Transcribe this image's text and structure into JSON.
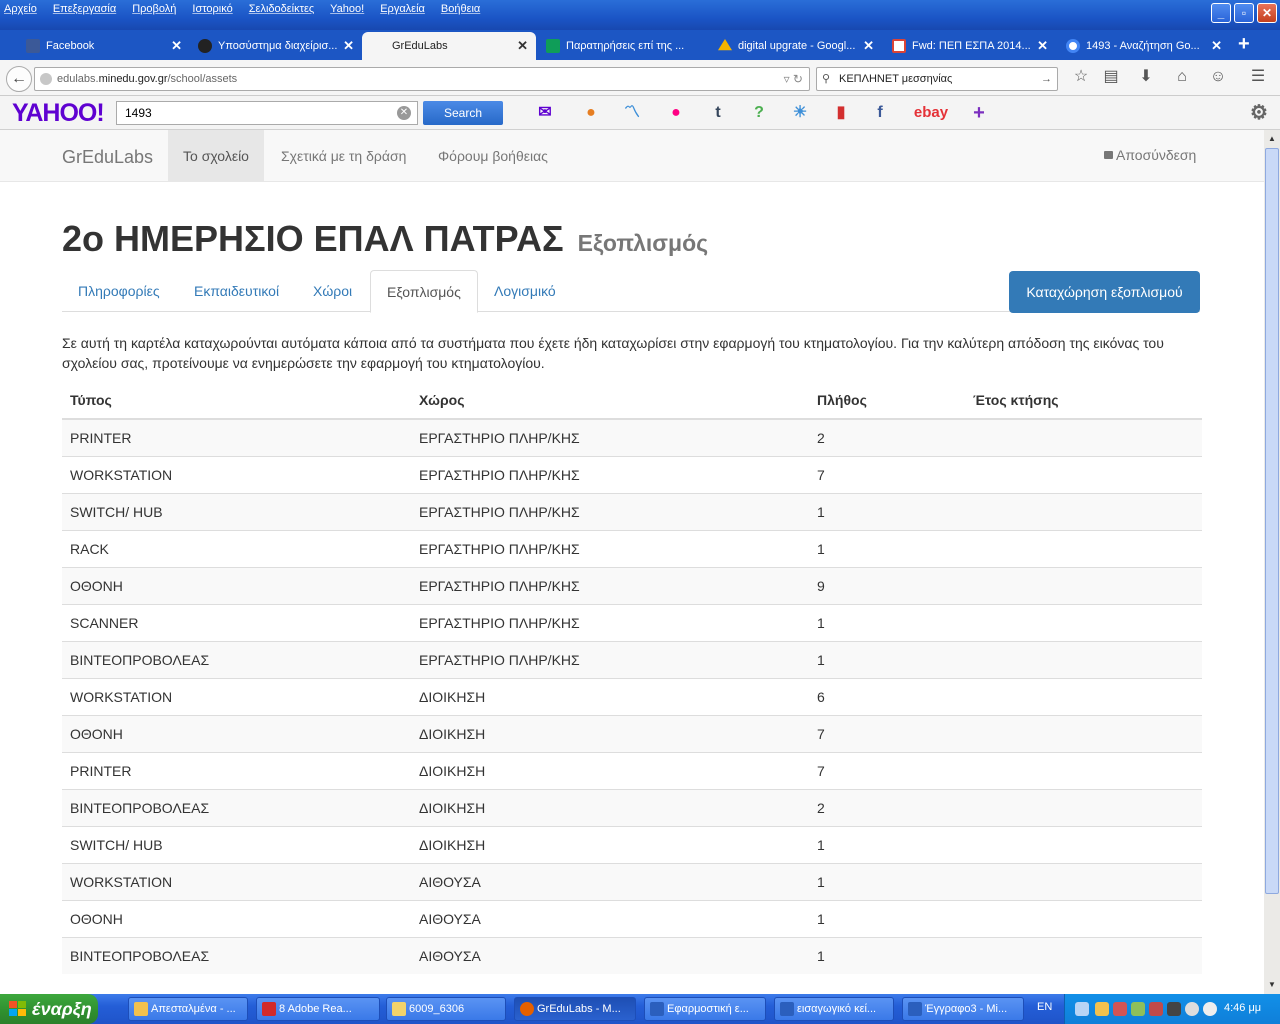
{
  "browser": {
    "menu": [
      "Αρχείο",
      "Επεξεργασία",
      "Προβολή",
      "Ιστορικό",
      "Σελιδοδείκτες",
      "Yahoo!",
      "Εργαλεία",
      "Βοήθεια"
    ],
    "tabs": [
      {
        "label": "Facebook",
        "icon_color": "#3b5998"
      },
      {
        "label": "Υποσύστημα διαχείρισ...",
        "icon_color": "#222222"
      },
      {
        "label": "GrEduLabs",
        "icon_color": ""
      },
      {
        "label": "Παρατηρήσεις επί της ...",
        "icon_color": "#0f9d58"
      },
      {
        "label": "digital upgrate - Googl...",
        "icon_color": "#f4b400"
      },
      {
        "label": "Fwd: ΠΕΠ ΕΣΠΑ 2014...",
        "icon_color": "#db4437"
      },
      {
        "label": "1493 - Αναζήτηση Go...",
        "icon_color": "#4285f4"
      }
    ],
    "new_tab_label": "+",
    "url_prefix": "edulabs.",
    "url_domain": "minedu.gov.gr",
    "url_path": "/school/assets",
    "search_value": "ΚΕΠΛΗΝΕΤ μεσσηνίας"
  },
  "yahoo": {
    "logo": "YAHOO!",
    "search_value": "1493",
    "search_button": "Search"
  },
  "site": {
    "brand": "GrEduLabs",
    "nav": [
      "Το σχολείο",
      "Σχετικά με τη δράση",
      "Φόρουμ βοήθειας"
    ],
    "logout": "Αποσύνδεση"
  },
  "page": {
    "title": "2ο ΗΜΕΡΗΣΙΟ ΕΠΑΛ ΠΑΤΡΑΣ",
    "subtitle": "Εξοπλισμός",
    "tabs": [
      "Πληροφορίες",
      "Εκπαιδευτικοί",
      "Χώροι",
      "Εξοπλισμός",
      "Λογισμικό"
    ],
    "add_button": "Καταχώρηση εξοπλισμού",
    "description": "Σε αυτή τη καρτέλα καταχωρούνται αυτόματα κάποια από τα συστήματα που έχετε ήδη καταχωρίσει στην εφαρμογή του κτηματολογίου. Για την καλύτερη απόδοση της εικόνας του σχολείου σας, προτείνουμε να ενημερώσετε την εφαρμογή του κτηματολογίου.",
    "table": {
      "headers": [
        "Τύπος",
        "Χώρος",
        "Πλήθος",
        "Έτος κτήσης"
      ],
      "rows": [
        [
          "PRINTER",
          "ΕΡΓΑΣΤΗΡΙΟ ΠΛΗΡ/ΚΗΣ",
          "2",
          ""
        ],
        [
          "WORKSTATION",
          "ΕΡΓΑΣΤΗΡΙΟ ΠΛΗΡ/ΚΗΣ",
          "7",
          ""
        ],
        [
          "SWITCH/ HUB",
          "ΕΡΓΑΣΤΗΡΙΟ ΠΛΗΡ/ΚΗΣ",
          "1",
          ""
        ],
        [
          "RACK",
          "ΕΡΓΑΣΤΗΡΙΟ ΠΛΗΡ/ΚΗΣ",
          "1",
          ""
        ],
        [
          "ΟΘΟΝΗ",
          "ΕΡΓΑΣΤΗΡΙΟ ΠΛΗΡ/ΚΗΣ",
          "9",
          ""
        ],
        [
          "SCANNER",
          "ΕΡΓΑΣΤΗΡΙΟ ΠΛΗΡ/ΚΗΣ",
          "1",
          ""
        ],
        [
          "ΒΙΝΤΕΟΠΡΟΒΟΛΕΑΣ",
          "ΕΡΓΑΣΤΗΡΙΟ ΠΛΗΡ/ΚΗΣ",
          "1",
          ""
        ],
        [
          "WORKSTATION",
          "ΔΙΟΙΚΗΣΗ",
          "6",
          ""
        ],
        [
          "ΟΘΟΝΗ",
          "ΔΙΟΙΚΗΣΗ",
          "7",
          ""
        ],
        [
          "PRINTER",
          "ΔΙΟΙΚΗΣΗ",
          "7",
          ""
        ],
        [
          "ΒΙΝΤΕΟΠΡΟΒΟΛΕΑΣ",
          "ΔΙΟΙΚΗΣΗ",
          "2",
          ""
        ],
        [
          "SWITCH/ HUB",
          "ΔΙΟΙΚΗΣΗ",
          "1",
          ""
        ],
        [
          "WORKSTATION",
          "ΑΙΘΟΥΣΑ",
          "1",
          ""
        ],
        [
          "ΟΘΟΝΗ",
          "ΑΙΘΟΥΣΑ",
          "1",
          ""
        ],
        [
          "ΒΙΝΤΕΟΠΡΟΒΟΛΕΑΣ",
          "ΑΙΘΟΥΣΑ",
          "1",
          ""
        ]
      ]
    }
  },
  "taskbar": {
    "start_label": "έναρξη",
    "items": [
      {
        "label": "Απεσταλμένα - ...",
        "icon_color": "#f2c14e"
      },
      {
        "label": "8 Adobe Rea...",
        "icon_color": "#d12a2a"
      },
      {
        "label": "6009_6306",
        "icon_color": "#f2d36b"
      },
      {
        "label": "GrEduLabs - M...",
        "icon_color": "#e66000"
      },
      {
        "label": "Εφαρμοστική ε...",
        "icon_color": "#2b5fbd"
      },
      {
        "label": "εισαγωγικό κεί...",
        "icon_color": "#2b5fbd"
      },
      {
        "label": "Έγγραφο3 - Mi...",
        "icon_color": "#2b5fbd"
      }
    ],
    "language": "EN",
    "clock": "4:46 μμ"
  }
}
